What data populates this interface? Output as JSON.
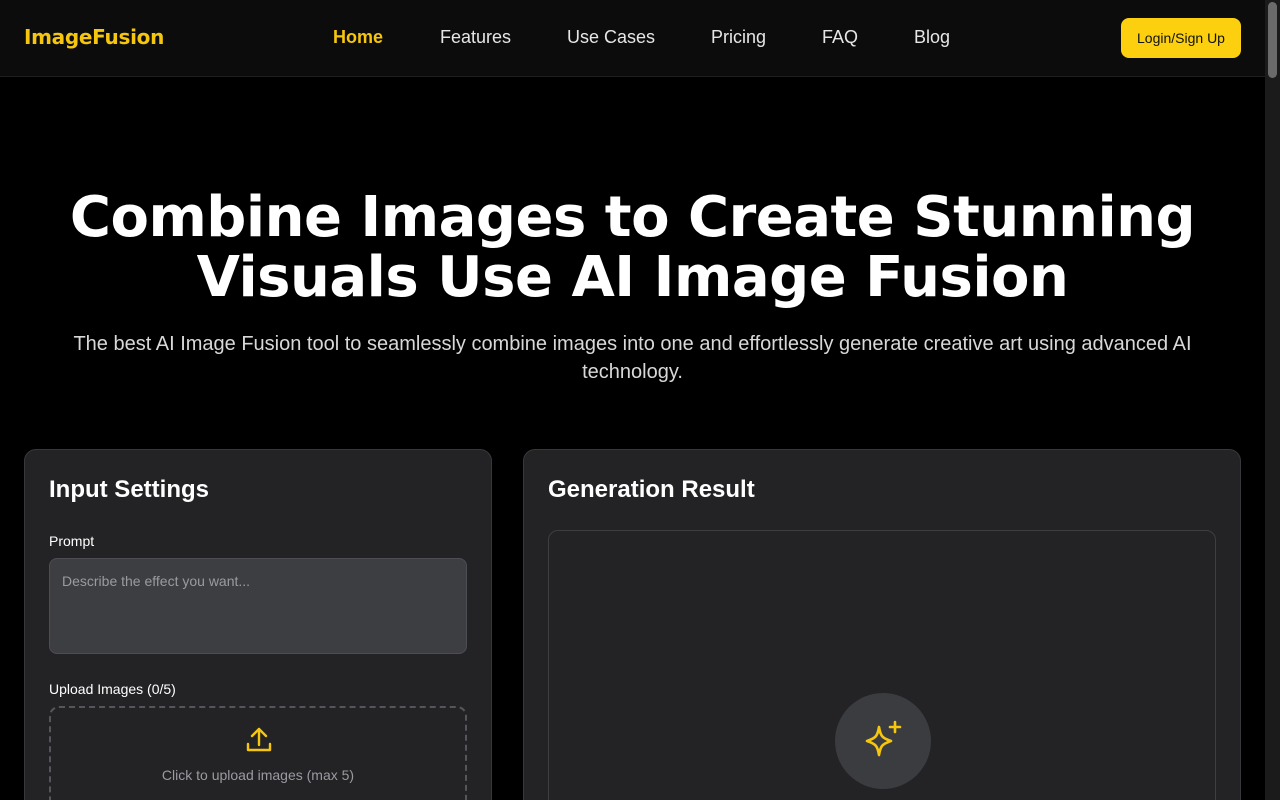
{
  "brand": {
    "logo": "ImageFusion",
    "accent": "#f6c60f"
  },
  "nav": {
    "items": [
      {
        "label": "Home",
        "active": true
      },
      {
        "label": "Features",
        "active": false
      },
      {
        "label": "Use Cases",
        "active": false
      },
      {
        "label": "Pricing",
        "active": false
      },
      {
        "label": "FAQ",
        "active": false
      },
      {
        "label": "Blog",
        "active": false
      }
    ],
    "login_label": "Login/Sign Up"
  },
  "hero": {
    "title_line1": "Combine Images to Create Stunning",
    "title_line2": "Visuals Use AI Image Fusion",
    "subtitle": "The best AI Image Fusion tool to seamlessly combine images into one and effortlessly generate creative art using advanced AI technology."
  },
  "input_panel": {
    "title": "Input Settings",
    "prompt_label": "Prompt",
    "prompt_placeholder": "Describe the effect you want...",
    "prompt_value": "",
    "upload_label": "Upload Images (0/5)",
    "upload_hint": "Click to upload images (max 5)",
    "upload_icon": "upload-icon"
  },
  "result_panel": {
    "title": "Generation Result",
    "placeholder_icon": "sparkles-icon"
  }
}
